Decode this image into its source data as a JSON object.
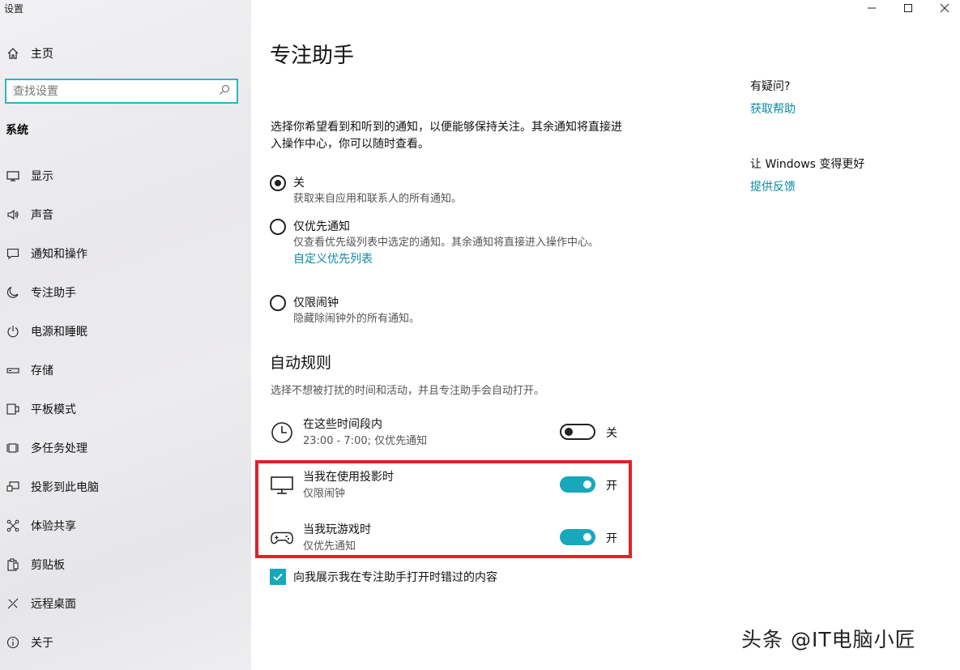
{
  "window": {
    "title": "设置",
    "controls": [
      "minimize",
      "maximize",
      "close"
    ]
  },
  "sidebar": {
    "home_label": "主页",
    "search_placeholder": "查找设置",
    "section_label": "系统",
    "items": [
      {
        "label": "显示",
        "icon": "display-icon"
      },
      {
        "label": "声音",
        "icon": "speaker-icon"
      },
      {
        "label": "通知和操作",
        "icon": "notification-icon"
      },
      {
        "label": "专注助手",
        "icon": "moon-icon"
      },
      {
        "label": "电源和睡眠",
        "icon": "power-icon"
      },
      {
        "label": "存储",
        "icon": "storage-icon"
      },
      {
        "label": "平板模式",
        "icon": "tablet-icon"
      },
      {
        "label": "多任务处理",
        "icon": "multitask-icon"
      },
      {
        "label": "投影到此电脑",
        "icon": "project-icon"
      },
      {
        "label": "体验共享",
        "icon": "share-icon"
      },
      {
        "label": "剪贴板",
        "icon": "clipboard-icon"
      },
      {
        "label": "远程桌面",
        "icon": "remote-icon"
      },
      {
        "label": "关于",
        "icon": "info-icon"
      }
    ]
  },
  "main": {
    "title": "专注助手",
    "intro": "选择你希望看到和听到的通知，以便能够保持关注。其余通知将直接进入操作中心，你可以随时查看。",
    "options": [
      {
        "label": "关",
        "desc": "获取来自应用和联系人的所有通知。",
        "checked": true
      },
      {
        "label": "仅优先通知",
        "desc": "仅查看优先级列表中选定的通知。其余通知将直接进入操作中心。",
        "link": "自定义优先列表",
        "checked": false
      },
      {
        "label": "仅限闹钟",
        "desc": "隐藏除闹钟外的所有通知。",
        "checked": false
      }
    ],
    "auto_rules": {
      "heading": "自动规则",
      "desc": "选择不想被打扰的时间和活动，并且专注助手会自动打开。",
      "rules": [
        {
          "title": "在这些时间段内",
          "sub": "23:00 - 7:00; 仅优先通知",
          "state": "关",
          "on": false,
          "icon": "clock-icon"
        },
        {
          "title": "当我在使用投影时",
          "sub": "仅限闹钟",
          "state": "开",
          "on": true,
          "icon": "monitor-icon"
        },
        {
          "title": "当我玩游戏时",
          "sub": "仅优先通知",
          "state": "开",
          "on": true,
          "icon": "gamepad-icon"
        }
      ]
    },
    "checkbox_label": "向我展示我在专注助手打开时错过的内容",
    "checkbox_checked": true
  },
  "right_panel": {
    "question": "有疑问?",
    "help_link": "获取帮助",
    "improve": "让 Windows 变得更好",
    "feedback_link": "提供反馈"
  },
  "watermark": "头条 @IT电脑小匠",
  "colors": {
    "accent": "#17a8bc",
    "link": "#0a8aa6",
    "highlight_box": "#e02128"
  }
}
